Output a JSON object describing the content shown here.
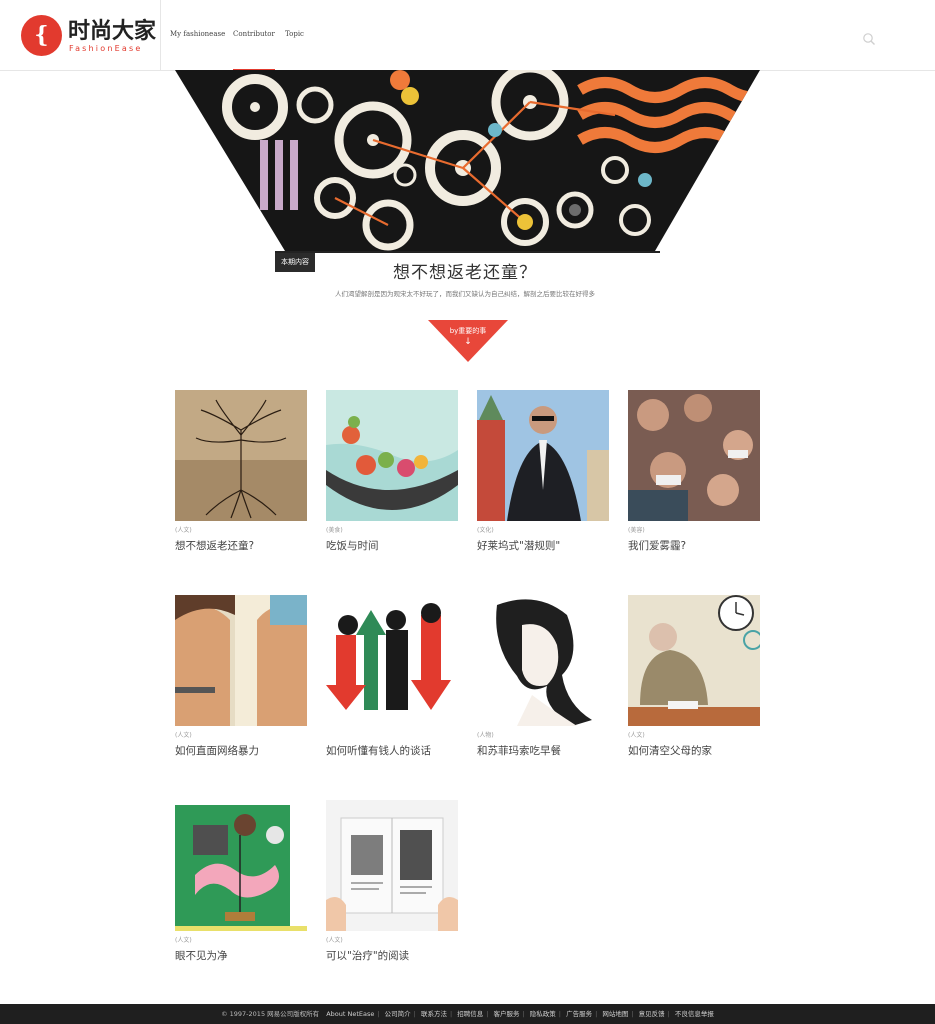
{
  "brand": {
    "mark": "{",
    "name_cn": "时尚大家",
    "name_en": "FashionEase",
    "accent": "#e23a2e"
  },
  "nav": {
    "items": [
      {
        "label": "My fashionease",
        "active": false
      },
      {
        "label": "Contributor",
        "active": true
      },
      {
        "label": "Topic",
        "active": false
      }
    ],
    "search_icon": "search-icon"
  },
  "issue": {
    "tag": "本期内容",
    "title": "想不想返老还童？",
    "description": "人们渴望解剖是因为观宋太不好玩了，而我们又缺认为自己纠结，解剖之后要比较在好得多",
    "button_label": "by重要的事",
    "button_icon": "arrow-down-icon"
  },
  "articles": [
    {
      "category": "(人文)",
      "title": "想不想返老还童?"
    },
    {
      "category": "(美食)",
      "title": "吃饭与时间"
    },
    {
      "category": "(文化)",
      "title": "好莱坞式\"潜规则\""
    },
    {
      "category": "(美容)",
      "title": "我们爱雾霾?"
    },
    {
      "category": "(人文)",
      "title": "如何直面网络暴力"
    },
    {
      "category": "",
      "title": "如何听懂有钱人的谈话"
    },
    {
      "category": "(人物)",
      "title": "和苏菲玛索吃早餐"
    },
    {
      "category": "(人文)",
      "title": "如何清空父母的家"
    },
    {
      "category": "(人文)",
      "title": "眼不见为净"
    },
    {
      "category": "(人文)",
      "title": "可以\"治疗\"的阅读"
    }
  ],
  "footer": {
    "copyright": "© 1997-2015 网易公司版权所有",
    "links": [
      "About NetEase",
      "公司简介",
      "联系方法",
      "招聘信息",
      "客户服务",
      "隐私政策",
      "广告服务",
      "网站地图",
      "意见反馈",
      "不良信息举报"
    ]
  }
}
